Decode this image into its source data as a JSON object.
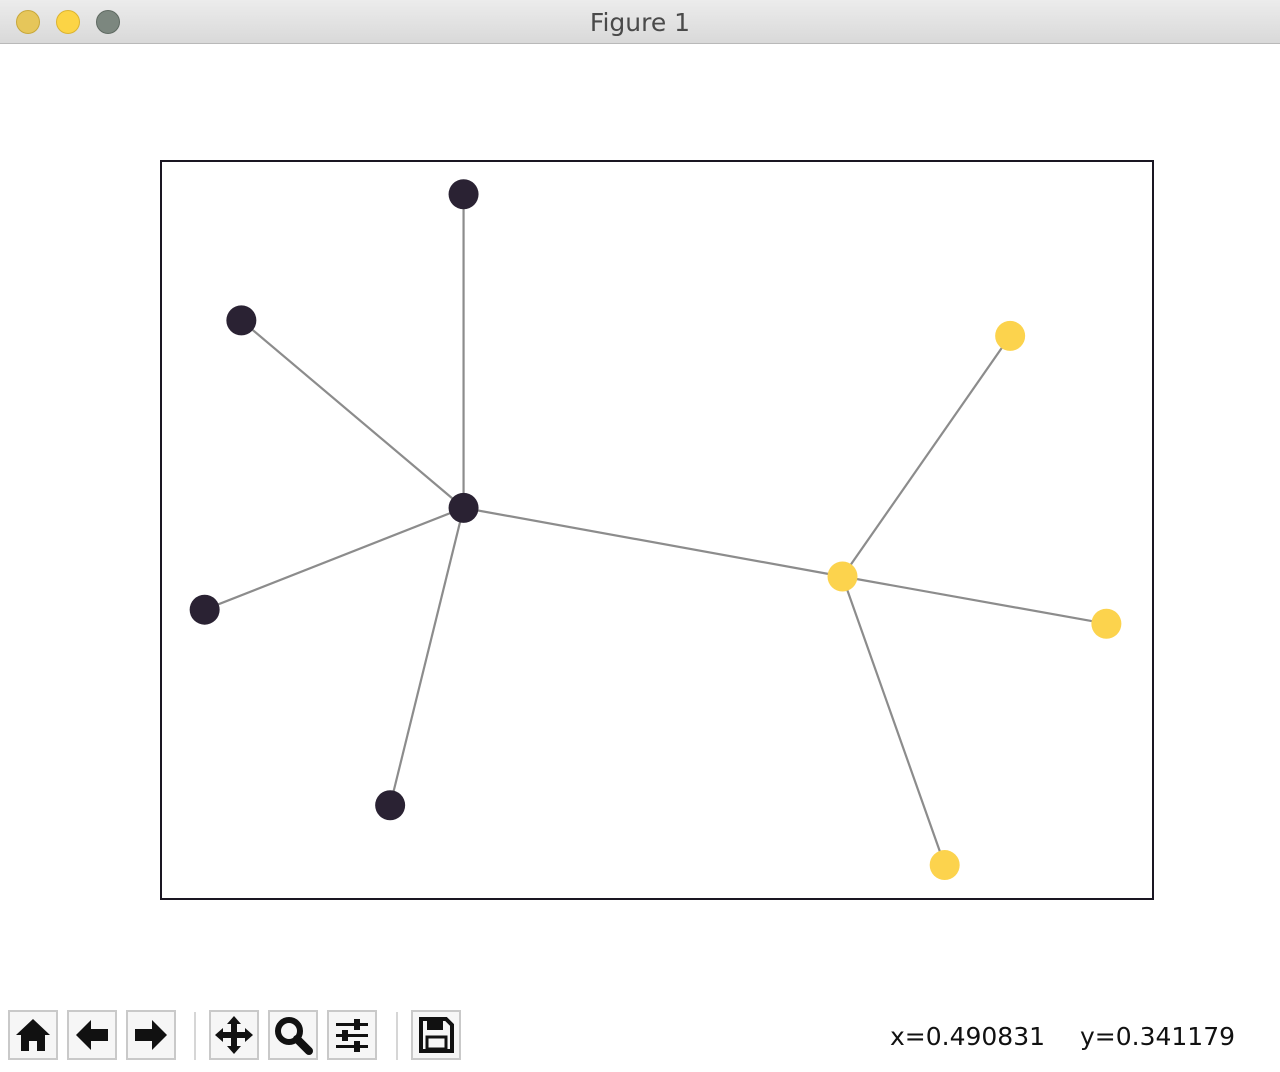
{
  "window": {
    "title": "Figure 1"
  },
  "toolbar": {
    "buttons": [
      {
        "icon": "home-icon"
      },
      {
        "icon": "back-arrow-icon"
      },
      {
        "icon": "forward-arrow-icon"
      },
      {
        "icon": "pan-move-icon"
      },
      {
        "icon": "zoom-magnifier-icon"
      },
      {
        "icon": "configure-subplots-icon"
      },
      {
        "icon": "save-floppy-icon"
      }
    ],
    "x_readout": "x=0.490831",
    "y_readout": "y=0.341179"
  },
  "colors": {
    "dark_node": "#2a2233",
    "light_node": "#fcd34d",
    "edge": "#8c8c8c",
    "axes_border": "#1a1622"
  },
  "chart_data": {
    "type": "scatter",
    "title": "",
    "xlabel": "",
    "ylabel": "",
    "xlim": [
      0,
      1
    ],
    "ylim": [
      0,
      1
    ],
    "grid": false,
    "nodes": [
      {
        "id": "n0",
        "x": 0.305,
        "y": 0.53,
        "group": "dark"
      },
      {
        "id": "n1",
        "x": 0.305,
        "y": 0.955,
        "group": "dark"
      },
      {
        "id": "n2",
        "x": 0.081,
        "y": 0.784,
        "group": "dark"
      },
      {
        "id": "n3",
        "x": 0.044,
        "y": 0.392,
        "group": "dark"
      },
      {
        "id": "n4",
        "x": 0.231,
        "y": 0.127,
        "group": "dark"
      },
      {
        "id": "n5",
        "x": 0.687,
        "y": 0.437,
        "group": "light"
      },
      {
        "id": "n6",
        "x": 0.856,
        "y": 0.763,
        "group": "light"
      },
      {
        "id": "n7",
        "x": 0.953,
        "y": 0.373,
        "group": "light"
      },
      {
        "id": "n8",
        "x": 0.79,
        "y": 0.046,
        "group": "light"
      }
    ],
    "edges": [
      [
        "n0",
        "n1"
      ],
      [
        "n0",
        "n2"
      ],
      [
        "n0",
        "n3"
      ],
      [
        "n0",
        "n4"
      ],
      [
        "n0",
        "n5"
      ],
      [
        "n5",
        "n6"
      ],
      [
        "n5",
        "n7"
      ],
      [
        "n5",
        "n8"
      ]
    ]
  }
}
